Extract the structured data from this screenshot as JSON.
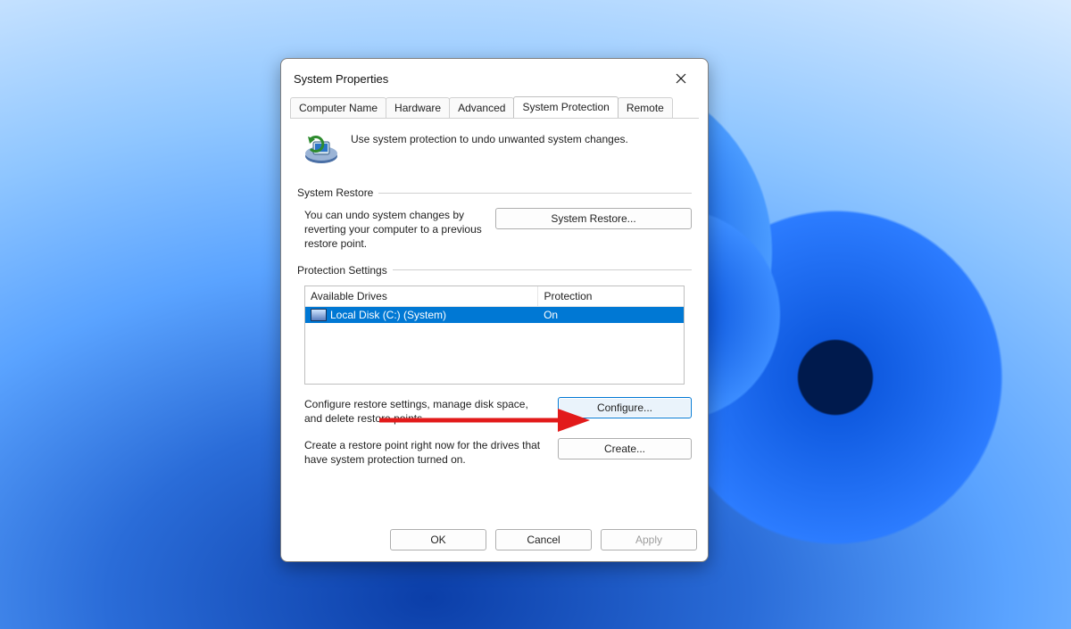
{
  "dialog": {
    "title": "System Properties"
  },
  "tabs": [
    {
      "label": "Computer Name"
    },
    {
      "label": "Hardware"
    },
    {
      "label": "Advanced"
    },
    {
      "label": "System Protection"
    },
    {
      "label": "Remote"
    }
  ],
  "intro_text": "Use system protection to undo unwanted system changes.",
  "section_restore": {
    "heading": "System Restore",
    "desc": "You can undo system changes by reverting your computer to a previous restore point.",
    "button": "System Restore..."
  },
  "section_protection": {
    "heading": "Protection Settings",
    "columns": {
      "drive": "Available Drives",
      "protection": "Protection"
    },
    "rows": [
      {
        "drive": "Local Disk (C:) (System)",
        "protection": "On"
      }
    ],
    "configure_desc": "Configure restore settings, manage disk space, and delete restore points.",
    "configure_button": "Configure...",
    "create_desc": "Create a restore point right now for the drives that have system protection turned on.",
    "create_button": "Create..."
  },
  "footer": {
    "ok": "OK",
    "cancel": "Cancel",
    "apply": "Apply"
  }
}
